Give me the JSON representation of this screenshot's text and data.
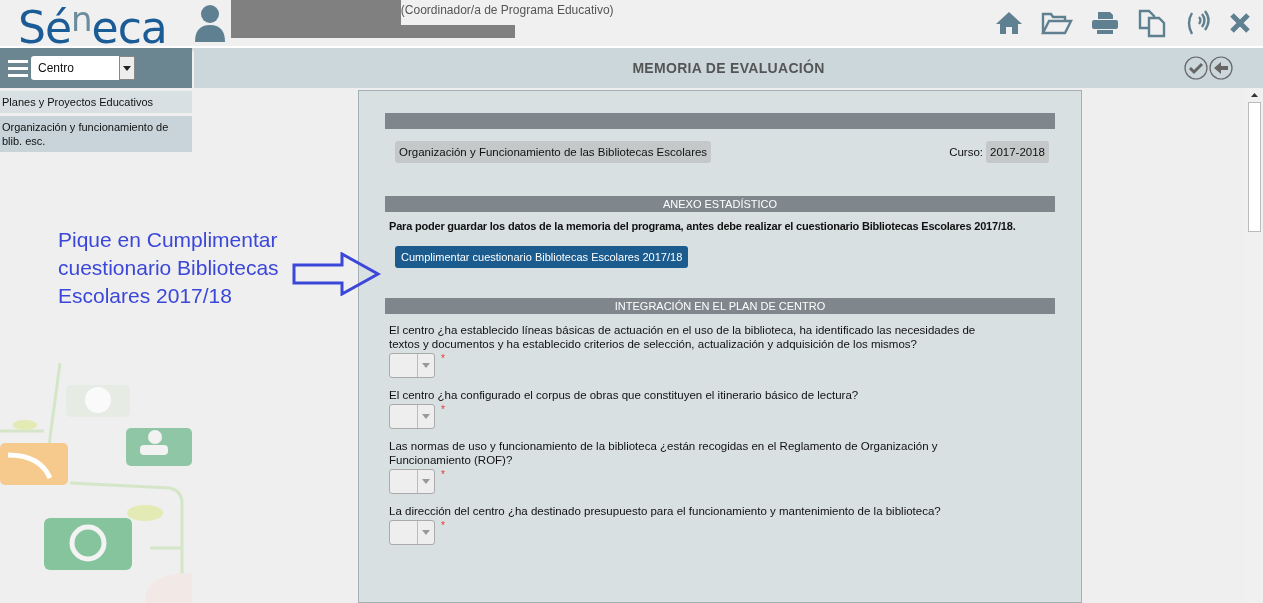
{
  "header": {
    "logo": "Sé$^{n}$eca",
    "role": "(Coordinador/a de Programa Educativo)"
  },
  "sidebar": {
    "selector": {
      "value": "Centro"
    },
    "items": [
      {
        "label": "Planes y Proyectos Educativos",
        "selected": false
      },
      {
        "label": "Organización y funcionamiento de blib. esc.",
        "selected": true
      }
    ]
  },
  "page_title": "MEMORIA DE EVALUACIÓN",
  "program": {
    "name": "Organización y Funcionamiento de las Bibliotecas Escolares",
    "course_label": "Curso:",
    "course": "2017-2018"
  },
  "annex": {
    "title": "ANEXO ESTADÍSTICO",
    "notice": "Para poder guardar los datos de la memoria del programa, antes debe realizar el cuestionario Bibliotecas Escolares 2017/18.",
    "button": "Cumplimentar cuestionario Bibliotecas Escolares 2017/18"
  },
  "integration": {
    "title": "INTEGRACIÓN EN EL PLAN DE CENTRO",
    "questions": [
      {
        "text": "El centro ¿ha establecido líneas básicas de actuación en el uso de la biblioteca, ha identificado las necesidades de textos y documentos y ha establecido criterios de selección, actualización y adquisición de los mismos?",
        "required_mark": "*"
      },
      {
        "text": "El centro ¿ha configurado el corpus de obras que constituyen el itinerario básico de lectura?",
        "required_mark": "*"
      },
      {
        "text": "Las normas de uso y funcionamiento de la biblioteca ¿están recogidas en el Reglamento de Organización y Funcionamiento (ROF)?",
        "required_mark": "*"
      },
      {
        "text": "La dirección del centro ¿ha destinado presupuesto para el funcionamiento y mantenimiento de la biblioteca?",
        "required_mark": "*"
      }
    ]
  },
  "annotation": "Pique en Cumplimentar cuestionario Bibliotecas Escolares 2017/18"
}
